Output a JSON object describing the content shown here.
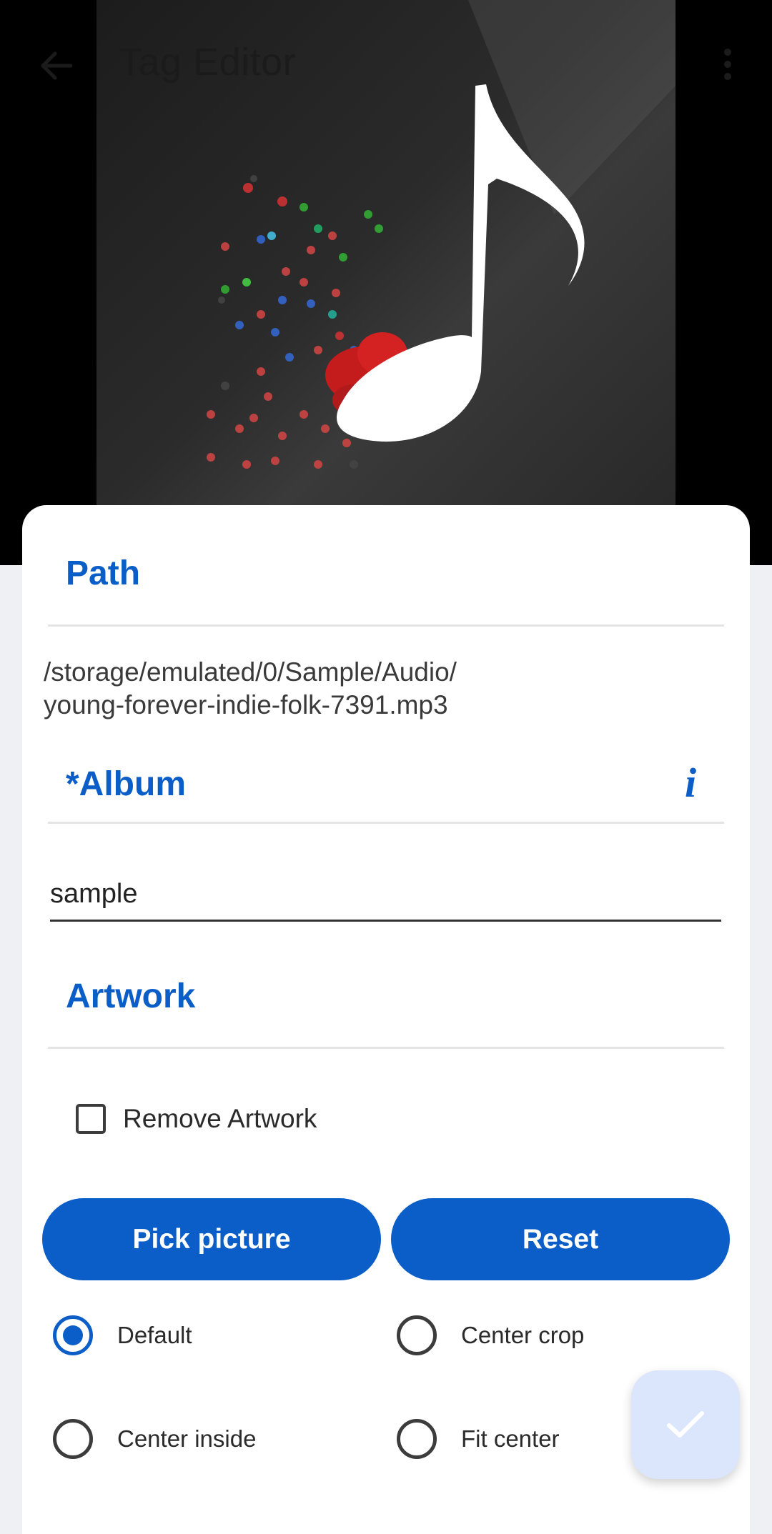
{
  "app_bar": {
    "title": "Tag Editor",
    "back_icon": "arrow-left-icon",
    "menu_icon": "more-vertical-icon"
  },
  "path_section": {
    "title": "Path",
    "value_line1": "/storage/emulated/0/Sample/Audio/",
    "value_line2": "young-forever-indie-folk-7391.mp3"
  },
  "album_section": {
    "title": "*Album",
    "info_icon": "i",
    "value": "sample"
  },
  "artwork_section": {
    "title": "Artwork",
    "remove_label": "Remove Artwork",
    "remove_checked": false,
    "pick_button": "Pick picture",
    "reset_button": "Reset",
    "scale_options": [
      {
        "label": "Default",
        "selected": true
      },
      {
        "label": "Center crop",
        "selected": false
      },
      {
        "label": "Center inside",
        "selected": false
      },
      {
        "label": "Fit center",
        "selected": false
      }
    ]
  },
  "fab": {
    "icon": "check-icon"
  },
  "colors": {
    "accent": "#0b5ec7",
    "fab_bg": "#dbe5fb"
  }
}
